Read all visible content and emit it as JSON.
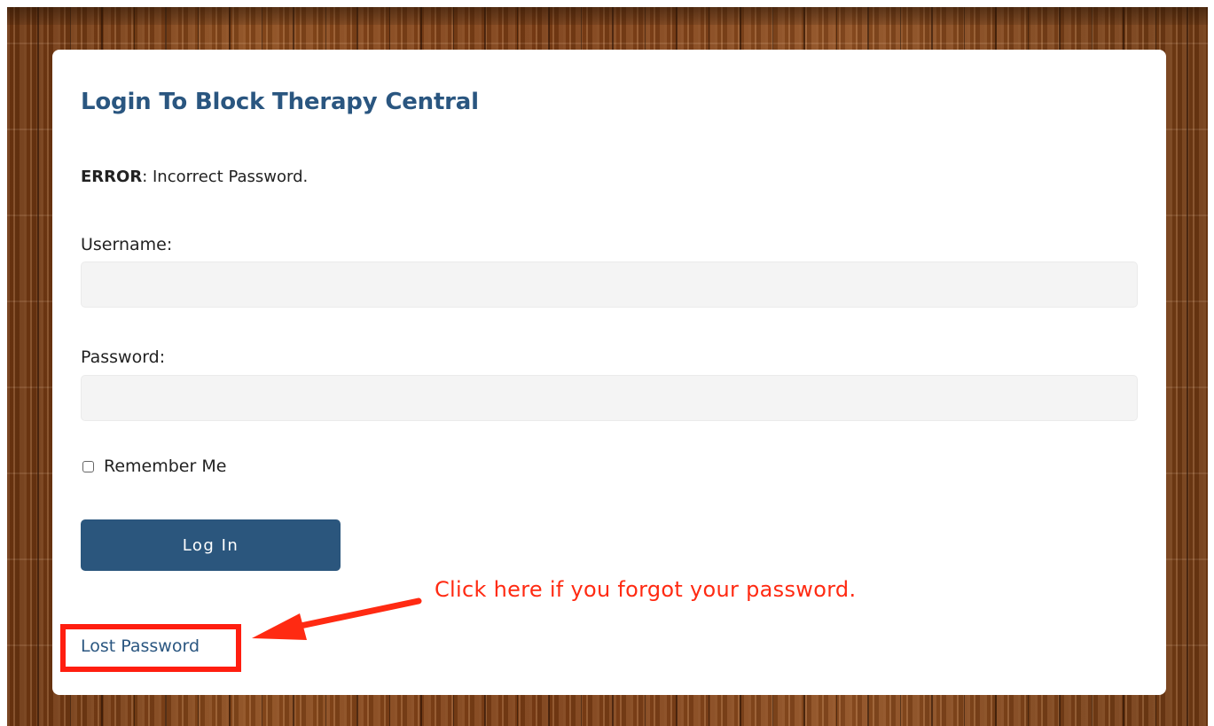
{
  "form": {
    "title": "Login To Block Therapy Central",
    "error_label": "ERROR",
    "error_message": ": Incorrect Password.",
    "username_label": "Username:",
    "username_value": "",
    "password_label": "Password:",
    "password_value": "",
    "remember_label": "Remember Me",
    "remember_checked": false,
    "login_button_label": "Log In",
    "lost_password_label": "Lost Password"
  },
  "annotation": {
    "text": "Click here if you forgot your password.",
    "color": "#ff2a12"
  },
  "colors": {
    "brand_blue": "#2b567d",
    "title_blue": "#2a5680",
    "highlight_red": "#ff1e10",
    "field_bg": "#f4f4f4"
  }
}
